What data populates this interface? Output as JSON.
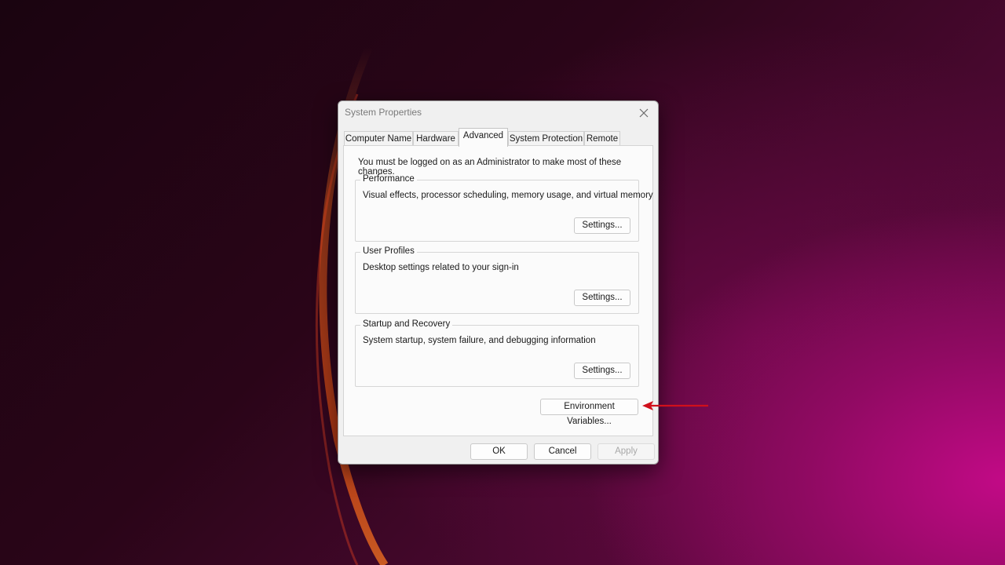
{
  "dialog": {
    "title": "System Properties",
    "tabs": [
      {
        "label": "Computer Name"
      },
      {
        "label": "Hardware"
      },
      {
        "label": "Advanced"
      },
      {
        "label": "System Protection"
      },
      {
        "label": "Remote"
      }
    ],
    "active_tab": "Advanced",
    "note": "You must be logged on as an Administrator to make most of these changes.",
    "groups": {
      "performance": {
        "title": "Performance",
        "description": "Visual effects, processor scheduling, memory usage, and virtual memory",
        "button": "Settings..."
      },
      "user_profiles": {
        "title": "User Profiles",
        "description": "Desktop settings related to your sign-in",
        "button": "Settings..."
      },
      "startup_recovery": {
        "title": "Startup and Recovery",
        "description": "System startup, system failure, and debugging information",
        "button": "Settings..."
      }
    },
    "env_button": "Environment Variables...",
    "footer": {
      "ok": "OK",
      "cancel": "Cancel",
      "apply": "Apply"
    }
  },
  "annotation": {
    "arrow_color": "#d0101c"
  },
  "icons": {
    "close": "close-icon"
  }
}
